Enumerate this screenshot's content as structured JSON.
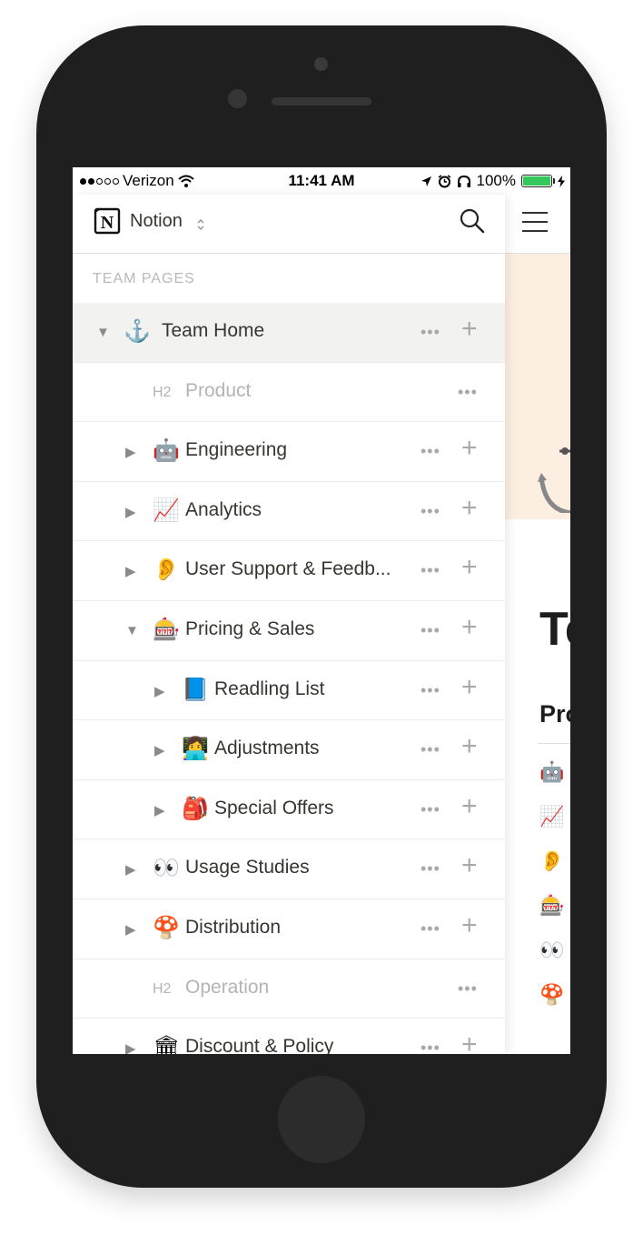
{
  "status_bar": {
    "carrier": "Verizon",
    "time": "11:41 AM",
    "battery": "100%",
    "battery_level": 1.0
  },
  "sidebar": {
    "workspace_name": "Notion",
    "section_label": "TEAM PAGES",
    "items": [
      {
        "type": "page",
        "label": "Team Home",
        "icon": "⚓",
        "indent": 0,
        "expanded": true,
        "active": true
      },
      {
        "type": "heading",
        "tag": "H2",
        "label": "Product",
        "indent": 1
      },
      {
        "type": "page",
        "label": "Engineering",
        "icon": "🤖",
        "indent": 1,
        "expanded": false
      },
      {
        "type": "page",
        "label": "Analytics",
        "icon": "📈",
        "indent": 1,
        "expanded": false
      },
      {
        "type": "page",
        "label": "User Support & Feedb...",
        "icon": "👂",
        "indent": 1,
        "expanded": false
      },
      {
        "type": "page",
        "label": "Pricing & Sales",
        "icon": "🎰",
        "indent": 1,
        "expanded": true
      },
      {
        "type": "page",
        "label": "Readling List",
        "icon": "📘",
        "indent": 2,
        "expanded": false
      },
      {
        "type": "page",
        "label": "Adjustments",
        "icon": "👩‍💻",
        "indent": 2,
        "expanded": false
      },
      {
        "type": "page",
        "label": "Special Offers",
        "icon": "🎒",
        "indent": 2,
        "expanded": false
      },
      {
        "type": "page",
        "label": "Usage Studies",
        "icon": "👀",
        "indent": 1,
        "expanded": false
      },
      {
        "type": "page",
        "label": "Distribution",
        "icon": "🍄",
        "indent": 1,
        "expanded": false
      },
      {
        "type": "heading",
        "tag": "H2",
        "label": "Operation",
        "indent": 1
      },
      {
        "type": "page",
        "label": "Discount & Policy",
        "icon": "🏛",
        "indent": 1,
        "expanded": false
      }
    ]
  },
  "page": {
    "title": "Te",
    "section_heading": "Pro",
    "list_icons": [
      "🤖",
      "📈",
      "👂",
      "🎰",
      "👀",
      "🍄"
    ]
  },
  "colors": {
    "cover": "#fdeee2",
    "battery": "#34c759",
    "text": "#37352f"
  }
}
